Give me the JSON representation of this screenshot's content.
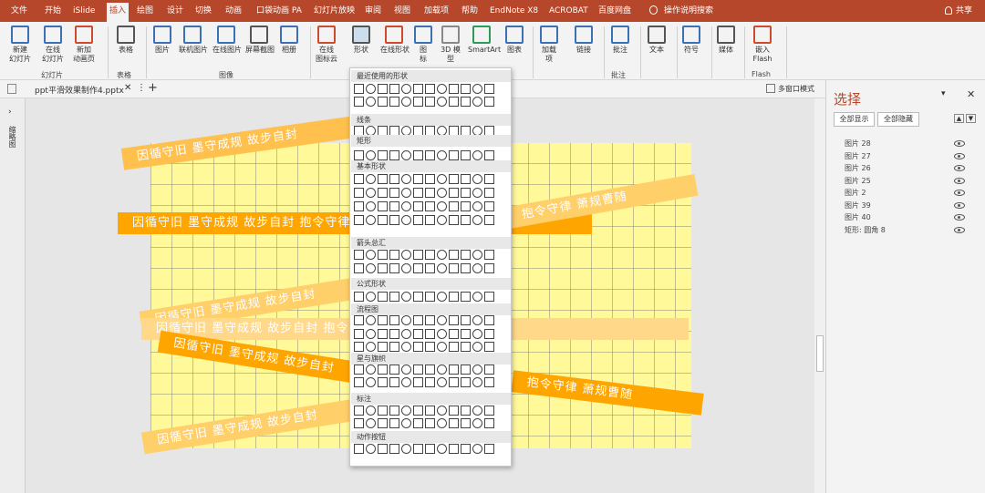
{
  "menu": {
    "tabs": [
      "文件",
      "开始",
      "iSlide",
      "插入",
      "绘图",
      "设计",
      "切换",
      "动画",
      "口袋动画 PA",
      "幻灯片放映",
      "审阅",
      "视图",
      "加载项",
      "帮助",
      "EndNote X8",
      "ACROBAT",
      "百度网盘",
      "操作说明搜索"
    ],
    "share": "共享"
  },
  "ribbon": {
    "buttons": [
      "新建\n幻灯片",
      "在线\n幻灯片",
      "新加\n动画页",
      "表格",
      "图片",
      "联机图片",
      "在线图片",
      "屏幕截图",
      "相册",
      "在线\n图标云",
      "形状",
      "在线形状",
      "图\n标",
      "3D 模\n型",
      "SmartArt",
      "图表",
      "加载\n项",
      "链接",
      "批注",
      "文本",
      "符号",
      "媒体",
      "嵌入\nFlash"
    ],
    "groups": [
      "幻灯片",
      "表格",
      "图像",
      "批注",
      "Flash"
    ]
  },
  "tabbar": {
    "file_tab": "ppt平滑效果制作4.pptx",
    "multiwindow": "多窗口模式"
  },
  "side": {
    "thumbnail_label": "缩略图"
  },
  "slide": {
    "bands": [
      {
        "text": "因循守旧    墨守成规    故步自封",
        "color": "#ffc04d"
      },
      {
        "text": "因循守旧    墨守成规    故步自封    抱令守律    萧规曹随",
        "color": "#ffa500"
      },
      {
        "text": "抱令守律    萧规曹随",
        "color": "#ffcf6a"
      },
      {
        "text": "因循守旧    墨守成规    故步自封",
        "color": "#ffcf6a"
      },
      {
        "text": "因循守旧    墨守成规    故步自封    抱令守律    萧规曹随",
        "color": "#ffd88a"
      },
      {
        "text": "因循守旧    墨守成规    故步自封",
        "color": "#ffa500"
      },
      {
        "text": "抱令守律    萧规曹随",
        "color": "#ffa500"
      },
      {
        "text": "因循守旧    墨守成规    故步自封",
        "color": "#ffcf6a"
      }
    ]
  },
  "shapes_menu": {
    "sections": [
      "最近使用的形状",
      "线条",
      "矩形",
      "基本形状",
      "箭头总汇",
      "公式形状",
      "流程图",
      "星与旗帜",
      "标注",
      "动作按钮"
    ]
  },
  "selection_pane": {
    "title": "选择",
    "show_all": "全部显示",
    "hide_all": "全部隐藏",
    "layers": [
      "图片 28",
      "图片 27",
      "图片 26",
      "图片 25",
      "图片 2",
      "图片 39",
      "图片 40",
      "矩形: 圆角 8"
    ]
  }
}
